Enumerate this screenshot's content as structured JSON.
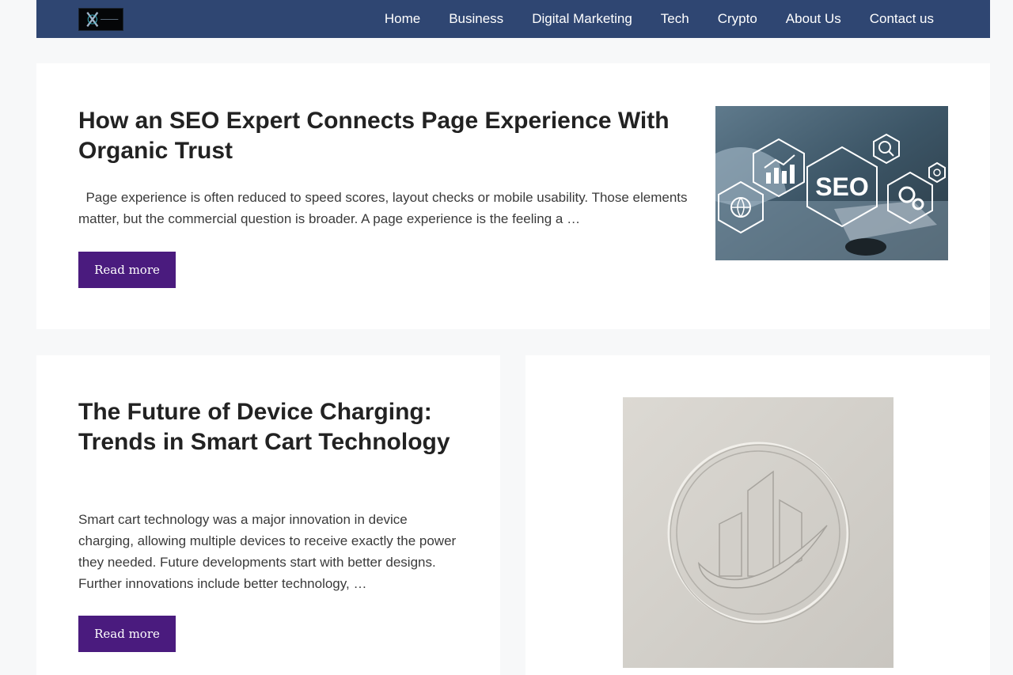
{
  "nav": {
    "items": [
      {
        "label": "Home"
      },
      {
        "label": "Business"
      },
      {
        "label": "Digital Marketing"
      },
      {
        "label": "Tech"
      },
      {
        "label": "Crypto"
      },
      {
        "label": "About Us"
      },
      {
        "label": "Contact us"
      }
    ]
  },
  "posts": [
    {
      "title": "How an SEO Expert Connects Page Experience With Organic Trust",
      "excerpt": "  Page experience is often reduced to speed scores, layout checks or mobile usability. Those elements matter, but the commercial question is broader. A page experience is the feeling a …",
      "read_more": "Read more",
      "image_text": "SEO"
    },
    {
      "title": "The Future of Device Charging: Trends in Smart Cart Technology",
      "excerpt": "Smart cart technology was a major innovation in device charging, allowing multiple devices to receive exactly the power they needed. Future developments start with better designs. Further innovations include better technology, …",
      "read_more": "Read more"
    }
  ],
  "colors": {
    "nav_bg": "#2f4672",
    "button_bg": "#4a1b7e",
    "page_bg": "#f7f8f9"
  }
}
